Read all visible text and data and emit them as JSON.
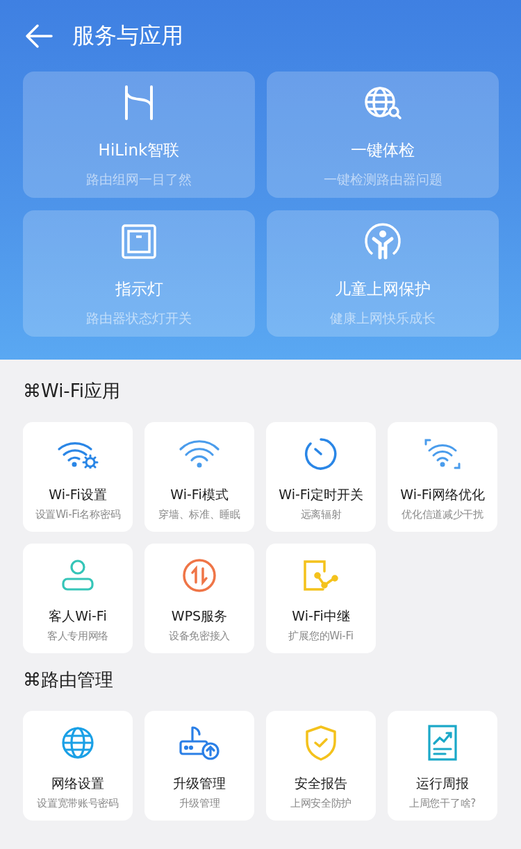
{
  "header": {
    "title": "服务与应用"
  },
  "feature_cards": [
    {
      "title": "HiLink智联",
      "subtitle": "路由组网一目了然"
    },
    {
      "title": "一键体检",
      "subtitle": "一键检测路由器问题"
    },
    {
      "title": "指示灯",
      "subtitle": "路由器状态灯开关"
    },
    {
      "title": "儿童上网保护",
      "subtitle": "健康上网快乐成长"
    }
  ],
  "sections": [
    {
      "title": "⌘Wi-Fi应用",
      "tiles": [
        {
          "title": "Wi-Fi设置",
          "subtitle": "设置Wi-Fi名称密码"
        },
        {
          "title": "Wi-Fi模式",
          "subtitle": "穿墙、标准、睡眠"
        },
        {
          "title": "Wi-Fi定时开关",
          "subtitle": "远离辐射"
        },
        {
          "title": "Wi-Fi网络优化",
          "subtitle": "优化信道减少干扰"
        },
        {
          "title": "客人Wi-Fi",
          "subtitle": "客人专用网络"
        },
        {
          "title": "WPS服务",
          "subtitle": "设备免密接入"
        },
        {
          "title": "Wi-Fi中继",
          "subtitle": "扩展您的Wi-Fi"
        }
      ]
    },
    {
      "title": "⌘路由管理",
      "tiles": [
        {
          "title": "网络设置",
          "subtitle": "设置宽带账号密码"
        },
        {
          "title": "升级管理",
          "subtitle": "升级管理"
        },
        {
          "title": "安全报告",
          "subtitle": "上网安全防护"
        },
        {
          "title": "运行周报",
          "subtitle": "上周您干了啥?"
        }
      ]
    }
  ]
}
